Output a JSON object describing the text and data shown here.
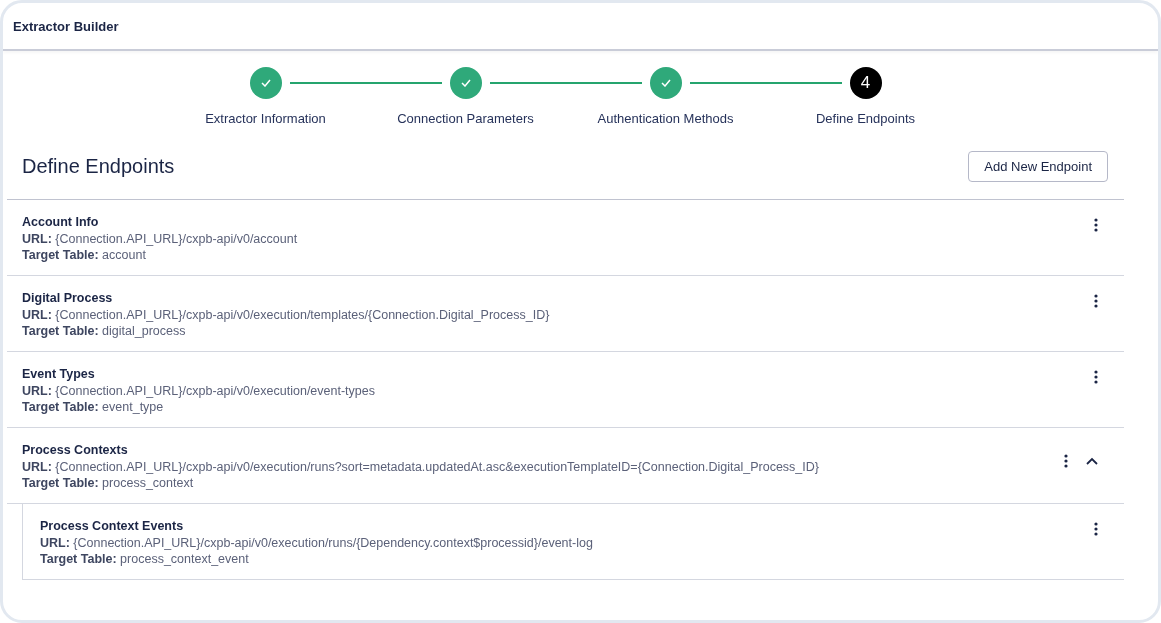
{
  "window": {
    "title": "Extractor Builder"
  },
  "steps": [
    {
      "label": "Extractor Information",
      "done": true
    },
    {
      "label": "Connection Parameters",
      "done": true
    },
    {
      "label": "Authentication Methods",
      "done": true
    },
    {
      "label": "Define Endpoints",
      "done": false,
      "number": "4"
    }
  ],
  "heading": "Define Endpoints",
  "add_button": "Add New Endpoint",
  "endpoints": [
    {
      "name": "Account Info",
      "url": "**URL:** {Connection.API_URL}/cxpb-api/v0/account",
      "target_table": "**Target Table:** account"
    },
    {
      "name": "Digital Process",
      "url": "**URL:** {Connection.API_URL}/cxpb-api/v0/execution/templates/{Connection.Digital_Process_ID}",
      "target_table": "**Target Table:** digital_process"
    },
    {
      "name": "Event Types",
      "url": "**URL:** {Connection.API_URL}/cxpb-api/v0/execution/event-types",
      "target_table": "**Target Table:** event_type"
    },
    {
      "name": "Process Contexts",
      "url": "**URL:** {Connection.API_URL}/cxpb-api/v0/execution/runs?sort=metadata.updatedAt.asc&executionTemplateID={Connection.Digital_Process_ID}",
      "target_table": "**Target Table:** process_context",
      "expanded": true,
      "children": [
        {
          "name": "Process Context Events",
          "url": "**URL:** {Connection.API_URL}/cxpb-api/v0/execution/runs/{Dependency.context$processid}/event-log",
          "target_table": "**Target Table:** process_context_event"
        }
      ]
    }
  ]
}
